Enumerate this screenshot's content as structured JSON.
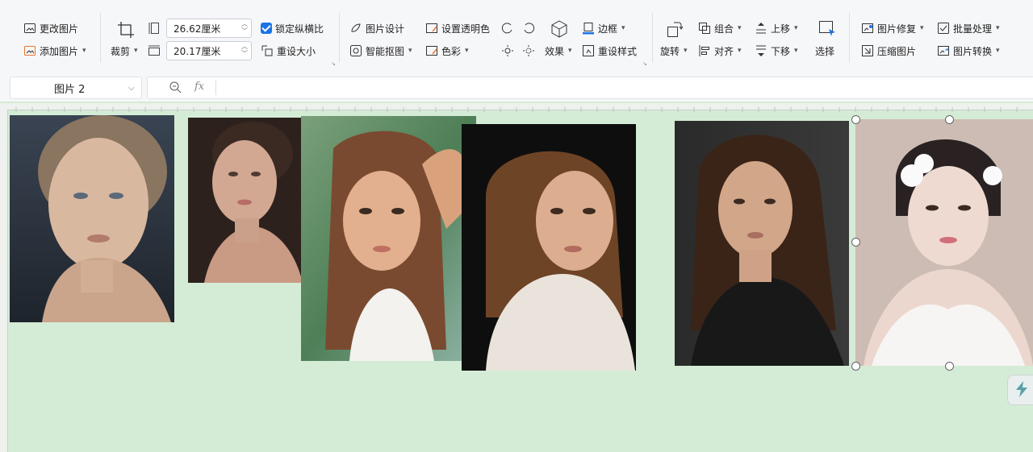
{
  "toolbar": {
    "change_image": "更改图片",
    "add_image": "添加图片",
    "crop": "裁剪",
    "width_value": "26.62厘米",
    "height_value": "20.17厘米",
    "lock_ratio": "锁定纵横比",
    "reset_size": "重设大小",
    "image_design": "图片设计",
    "smart_cutout": "智能抠图",
    "set_transparent": "设置透明色",
    "color": "色彩",
    "effect": "效果",
    "border": "边框",
    "reset_style": "重设样式",
    "rotate": "旋转",
    "group": "组合",
    "align": "对齐",
    "move_up": "上移",
    "move_down": "下移",
    "select": "选择",
    "image_repair": "图片修复",
    "compress_image": "压缩图片",
    "batch_process": "批量处理",
    "image_convert": "图片转换",
    "accent": "#1a73e8"
  },
  "formula": {
    "name_box": "图片 2",
    "fx": "fx"
  },
  "photos": [
    {
      "name": "portrait-1",
      "colors": [
        "#2b3440",
        "#c9a98f"
      ]
    },
    {
      "name": "portrait-2",
      "colors": [
        "#2a1f1b",
        "#c89c85"
      ]
    },
    {
      "name": "portrait-3",
      "colors": [
        "#5f8a5a",
        "#d8a37c"
      ]
    },
    {
      "name": "portrait-4",
      "colors": [
        "#121212",
        "#d6a282"
      ]
    },
    {
      "name": "portrait-5",
      "colors": [
        "#222222",
        "#c9a086"
      ]
    },
    {
      "name": "portrait-6",
      "colors": [
        "#c9b8b0",
        "#f0e5e0"
      ]
    }
  ],
  "background": "#d4ecd6"
}
